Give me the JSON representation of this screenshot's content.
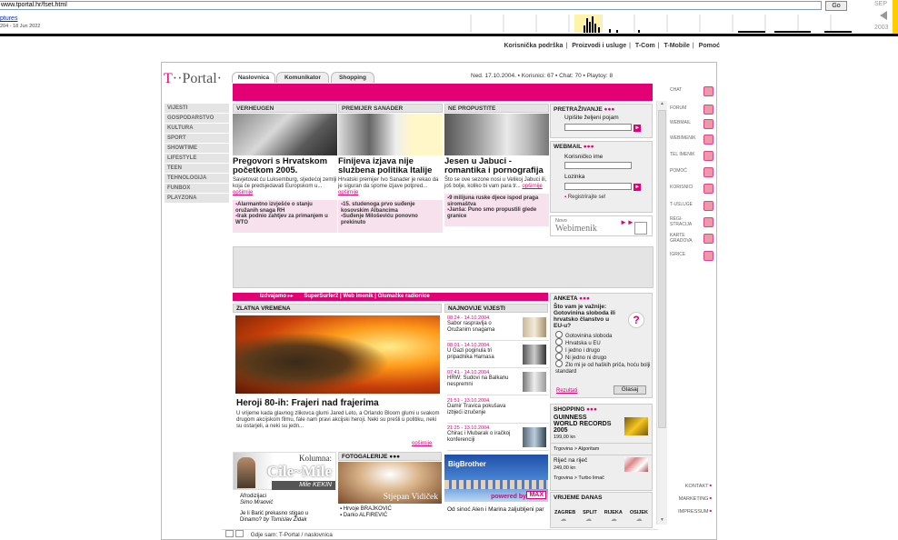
{
  "wayback": {
    "url": "www.tportal.hr/fset.html",
    "go": "Go",
    "captures": "ptures",
    "range": "204 - 18 Jun 2022",
    "month": "SEP",
    "year": "2003"
  },
  "toplinks": [
    "Korisnička podrška",
    "Proizvodi i usluge",
    "T-Com",
    "T-Mobile",
    "Pomoć"
  ],
  "logo": {
    "t": "T",
    "dots": "··",
    "text": "Portal"
  },
  "tabs": [
    "Naslovnica",
    "Komunikator",
    "Shopping"
  ],
  "header_info": "Ned. 17.10.2004.  ▪  Korisnici: 67  ▪  Chat: 70  ▪  Playtoy: 8",
  "left_menu": [
    "VIJESTI",
    "GOSPODARSTVO",
    "KULTURA",
    "SPORT",
    "SHOWTIME",
    "LIFESTYLE",
    "TEEN",
    "TEHNOLOGIJA",
    "FUNBOX",
    "PLAYZONA"
  ],
  "news": [
    {
      "header": "VERHEUGEN",
      "title": "Pregovori s Hrvatskom početkom 2005.",
      "text": "Savjetovat ću Luksemburg, sljedećoj zemlji koja će predsjedavati Europskom u...",
      "more": "opširnije",
      "bullets": [
        "Alarmantno izvješće o stanju oružanih snaga RH",
        "Irak podnio zahtjev za primanjem u WTO"
      ]
    },
    {
      "header": "PREMIJER SANADER",
      "title": "Finijeva izjava nije službena politika Italije",
      "text": "Hrvatski premijer Ivo Sanader je rekao da je siguran da spome izjave potpred...",
      "more": "opširnije",
      "bullets": [
        "15. studenoga prvo suđenje kosovskim Albancima",
        "Suđenje Miloševiću ponovno prekinuto"
      ]
    },
    {
      "header": "NE PROPUSTITE",
      "title": "Jesen u Jabuci - romantika i pornografija",
      "text": "Što se ove sezone nosi u Velikoj Jabuci ili, još bolje, koliko bi vam para tr...",
      "more": "opširnije",
      "bullets": [
        "9 milijuna ruske djece ispod praga siromaštva",
        "Janša: Puno smo propustili glede granice"
      ]
    }
  ],
  "search": {
    "title": "PRETRAŽIVANJE",
    "label": "Upišite željeni pojam"
  },
  "webmail": {
    "title": "WEBMAIL",
    "user_label": "Korisničko ime",
    "pass_label": "Lozinka",
    "register": "Registrirajte se!"
  },
  "webimenik": {
    "small": "Novo",
    "big": "Webimenik"
  },
  "izdvajamo": {
    "lead": "Izdvajamo",
    "items": "SuperSurfer2  |  Web imenik  |  Glumačke radionice"
  },
  "zlatna": {
    "header": "ZLATNA VREMENA",
    "title": "Heroji 80-ih: Frajeri nad frajerima",
    "text": "U vrijeme kada glavnog zlikovca glumi Jared Leto, a Orlando Bloom glumi u svakom drugom akcijskom filmu, fale nam pravi akcijski heroji. Neki su prešli u politiku, neki su ostarjeli, a neki su jedn...",
    "more": "opširnije"
  },
  "najnovije": {
    "header": "NAJNOVIJE VIJESTI",
    "items": [
      {
        "date": "08:24 - 14.10.2004.",
        "title": "Sabor raspravlja o Oružanim snagama"
      },
      {
        "date": "08:01 - 14.10.2004.",
        "title": "U Gazi poginula tri pripadnika Hamasa"
      },
      {
        "date": "07:41 - 14.10.2004.",
        "title": "HRW: Sudovi na Balkanu nespremni"
      },
      {
        "date": "21:51 - 13.10.2004.",
        "title": "Damir Travica pokušava izbjeći izručenje"
      },
      {
        "date": "21:25 - 13.10.2004.",
        "title": "Chirac i Mubarak o iračkoj konferenciji"
      }
    ]
  },
  "anketa": {
    "title": "ANKETA",
    "question": "Što vam je važnije: Gotovinina sloboda ili hrvatsko članstvo u EU-u?",
    "options": [
      "Gotovinina sloboda",
      "Hrvatska u EU",
      "I jedno i drugo",
      "Ni jedno ni drugo",
      "Zlo mi je od haških priča, hoću bolji standard"
    ],
    "results": "Rezultati",
    "vote": "Glasaj"
  },
  "shopping": {
    "title": "SHOPPING",
    "item1": {
      "name": "GUINNESS WORLD RECORDS 2005",
      "price": "199,00 kn",
      "store": "Trgovina > Algoritam"
    },
    "item2": {
      "name": "Riječ na riječ",
      "price": "249,00 kn",
      "store": "Trgovina > Turbo limač"
    }
  },
  "vrijeme": {
    "title": "VRIJEME DANAS",
    "cities": [
      "ZAGREB",
      "SPLIT",
      "RIJEKA",
      "OSIJEK"
    ]
  },
  "kolumna": {
    "label": "Kolumna:",
    "name": "Cile~Mile",
    "sub": "Mile KEKIN",
    "items": [
      {
        "title": "Afrodizijaci",
        "author": "Simo Mraović"
      },
      {
        "title": "Je li Barić prekasno stigao u Dinamo?",
        "author": "by Tomislav Židak"
      }
    ]
  },
  "foto": {
    "header": "FOTOGALERIJE",
    "caption": "Stjepan Vidiček",
    "items": [
      "Hrvoje BRAJKOVIĆ",
      "Darko ALFIREVIĆ"
    ]
  },
  "bigbrother": {
    "logo": "BigBrother",
    "powered": "powered by",
    "max": "MAX",
    "text": "Od sinoć Alen i Marina zaljubljeni par"
  },
  "services": [
    "CHAT",
    "FORUM",
    "WEBMAIL",
    "WEBIMENIK",
    "TEL IMENIK",
    "POMOĆ",
    "KORISNICI",
    "T-USLUGE",
    "REGI-STRACIJA",
    "KARTE GRADOVA",
    "IGRICE"
  ],
  "right_links": [
    "KONTAKT",
    "MARKETING",
    "IMPRESSUM"
  ],
  "footer": "Gdje sam: T-Portal / naslovnica",
  "colors": {
    "magenta": "#e20074",
    "grey": "#e4e4e4"
  }
}
